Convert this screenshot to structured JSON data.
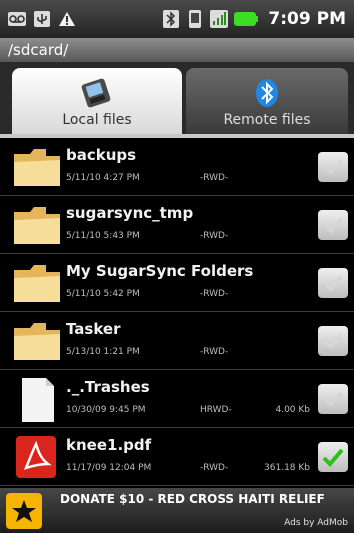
{
  "status_bar": {
    "time": "7:09 PM",
    "left_icons": [
      "voicemail-icon",
      "usb-icon",
      "warning-icon"
    ],
    "right_icons": [
      "bluetooth-icon",
      "vibrate-icon",
      "signal-icon",
      "battery-icon"
    ],
    "battery_color": "#3ddc27"
  },
  "path": "/sdcard/",
  "tabs": [
    {
      "label": "Local files",
      "icon": "phone-icon",
      "selected": true
    },
    {
      "label": "Remote files",
      "icon": "bluetooth-icon",
      "selected": false
    }
  ],
  "files": [
    {
      "name": "backups",
      "date": "5/11/10 4:27 PM",
      "perm": "-RWD-",
      "size": "",
      "type": "folder",
      "checked": false
    },
    {
      "name": "sugarsync_tmp",
      "date": "5/11/10 5:43 PM",
      "perm": "-RWD-",
      "size": "",
      "type": "folder",
      "checked": false
    },
    {
      "name": "My SugarSync Folders",
      "date": "5/11/10 5:42 PM",
      "perm": "-RWD-",
      "size": "",
      "type": "folder",
      "checked": false
    },
    {
      "name": "Tasker",
      "date": "5/13/10 1:21 PM",
      "perm": "-RWD-",
      "size": "",
      "type": "folder",
      "checked": false
    },
    {
      "name": "._.Trashes",
      "date": "10/30/09 9:45 PM",
      "perm": "HRWD-",
      "size": "4.00 Kb",
      "type": "file",
      "checked": false
    },
    {
      "name": "knee1.pdf",
      "date": "11/17/09 12:04 PM",
      "perm": "-RWD-",
      "size": "361.18 Kb",
      "type": "pdf",
      "checked": true
    }
  ],
  "ad": {
    "text": "DONATE $10 - RED CROSS HAITI RELIEF",
    "by": "Ads by AdMob"
  }
}
